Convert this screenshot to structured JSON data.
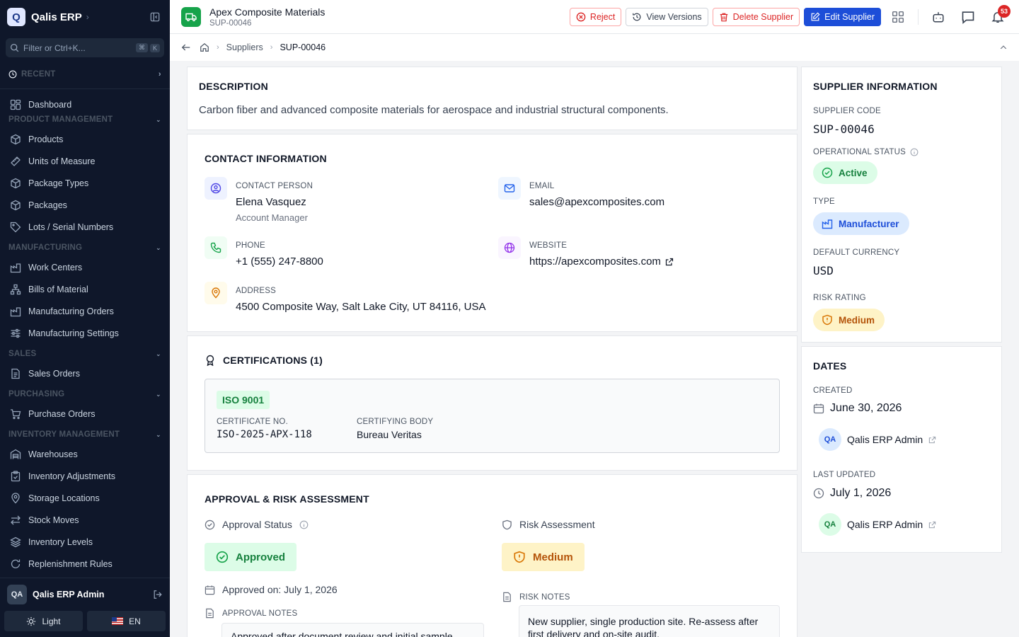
{
  "app": {
    "brand": "Qalis ERP",
    "logo_letter": "Q"
  },
  "sidebar": {
    "filter_placeholder": "Filter or Ctrl+K...",
    "kbd1": "⌘",
    "kbd2": "K",
    "recent": "RECENT",
    "dashboard": "Dashboard",
    "sections": {
      "product": "PRODUCT MANAGEMENT",
      "manufacturing": "MANUFACTURING",
      "sales": "SALES",
      "purchasing": "PURCHASING",
      "inventory": "INVENTORY MANAGEMENT"
    },
    "product_items": [
      "Products",
      "Units of Measure",
      "Package Types",
      "Packages",
      "Lots / Serial Numbers"
    ],
    "manufacturing_items": [
      "Work Centers",
      "Bills of Material",
      "Manufacturing Orders",
      "Manufacturing Settings"
    ],
    "sales_items": [
      "Sales Orders"
    ],
    "purchasing_items": [
      "Purchase Orders"
    ],
    "inventory_items": [
      "Warehouses",
      "Inventory Adjustments",
      "Storage Locations",
      "Stock Moves",
      "Inventory Levels",
      "Replenishment Rules"
    ],
    "user": {
      "initials": "QA",
      "name": "Qalis ERP Admin"
    },
    "theme_label": "Light",
    "lang_label": "EN"
  },
  "header": {
    "title": "Apex Composite Materials",
    "code": "SUP-00046",
    "reject": "Reject",
    "view_versions": "View Versions",
    "delete": "Delete Supplier",
    "edit": "Edit Supplier",
    "notif_count": "53"
  },
  "breadcrumb": {
    "parent": "Suppliers",
    "current": "SUP-00046"
  },
  "description": {
    "heading": "DESCRIPTION",
    "text": "Carbon fiber and advanced composite materials for aerospace and industrial structural components."
  },
  "contact": {
    "heading": "CONTACT INFORMATION",
    "person_label": "CONTACT PERSON",
    "person": "Elena Vasquez",
    "role": "Account Manager",
    "email_label": "EMAIL",
    "email": "sales@apexcomposites.com",
    "phone_label": "PHONE",
    "phone": "+1 (555) 247-8800",
    "website_label": "WEBSITE",
    "website": "https://apexcomposites.com",
    "address_label": "ADDRESS",
    "address": "4500 Composite Way, Salt Lake City, UT 84116, USA"
  },
  "certifications": {
    "heading": "CERTIFICATIONS (1)",
    "items": [
      {
        "name": "ISO 9001",
        "cert_no_label": "CERTIFICATE NO.",
        "cert_no": "ISO-2025-APX-118",
        "body_label": "CERTIFYING BODY",
        "body": "Bureau Veritas"
      }
    ]
  },
  "approval": {
    "heading": "APPROVAL & RISK ASSESSMENT",
    "status_label": "Approval Status",
    "status": "Approved",
    "approved_on": "Approved on: July 1, 2026",
    "notes_label": "APPROVAL NOTES",
    "notes": "Approved after document review and initial sample",
    "risk_label": "Risk Assessment",
    "risk": "Medium",
    "risk_notes_label": "RISK NOTES",
    "risk_notes": "New supplier, single production site. Re-assess after first delivery and on-site audit."
  },
  "supplier_info": {
    "heading": "SUPPLIER INFORMATION",
    "code_label": "SUPPLIER CODE",
    "code": "SUP-00046",
    "op_status_label": "OPERATIONAL STATUS",
    "op_status": "Active",
    "type_label": "TYPE",
    "type": "Manufacturer",
    "currency_label": "DEFAULT CURRENCY",
    "currency": "USD",
    "risk_label": "RISK RATING",
    "risk": "Medium"
  },
  "dates": {
    "heading": "DATES",
    "created_label": "CREATED",
    "created": "June 30, 2026",
    "created_by": "Qalis ERP Admin",
    "created_by_initials": "QA",
    "updated_label": "LAST UPDATED",
    "updated": "July 1, 2026",
    "updated_by": "Qalis ERP Admin",
    "updated_by_initials": "QA"
  },
  "colors": {
    "sidebar_bg": "#0f172a",
    "primary": "#1d4ed8",
    "danger": "#dc2626",
    "success": "#16a34a",
    "warning": "#d97706"
  }
}
